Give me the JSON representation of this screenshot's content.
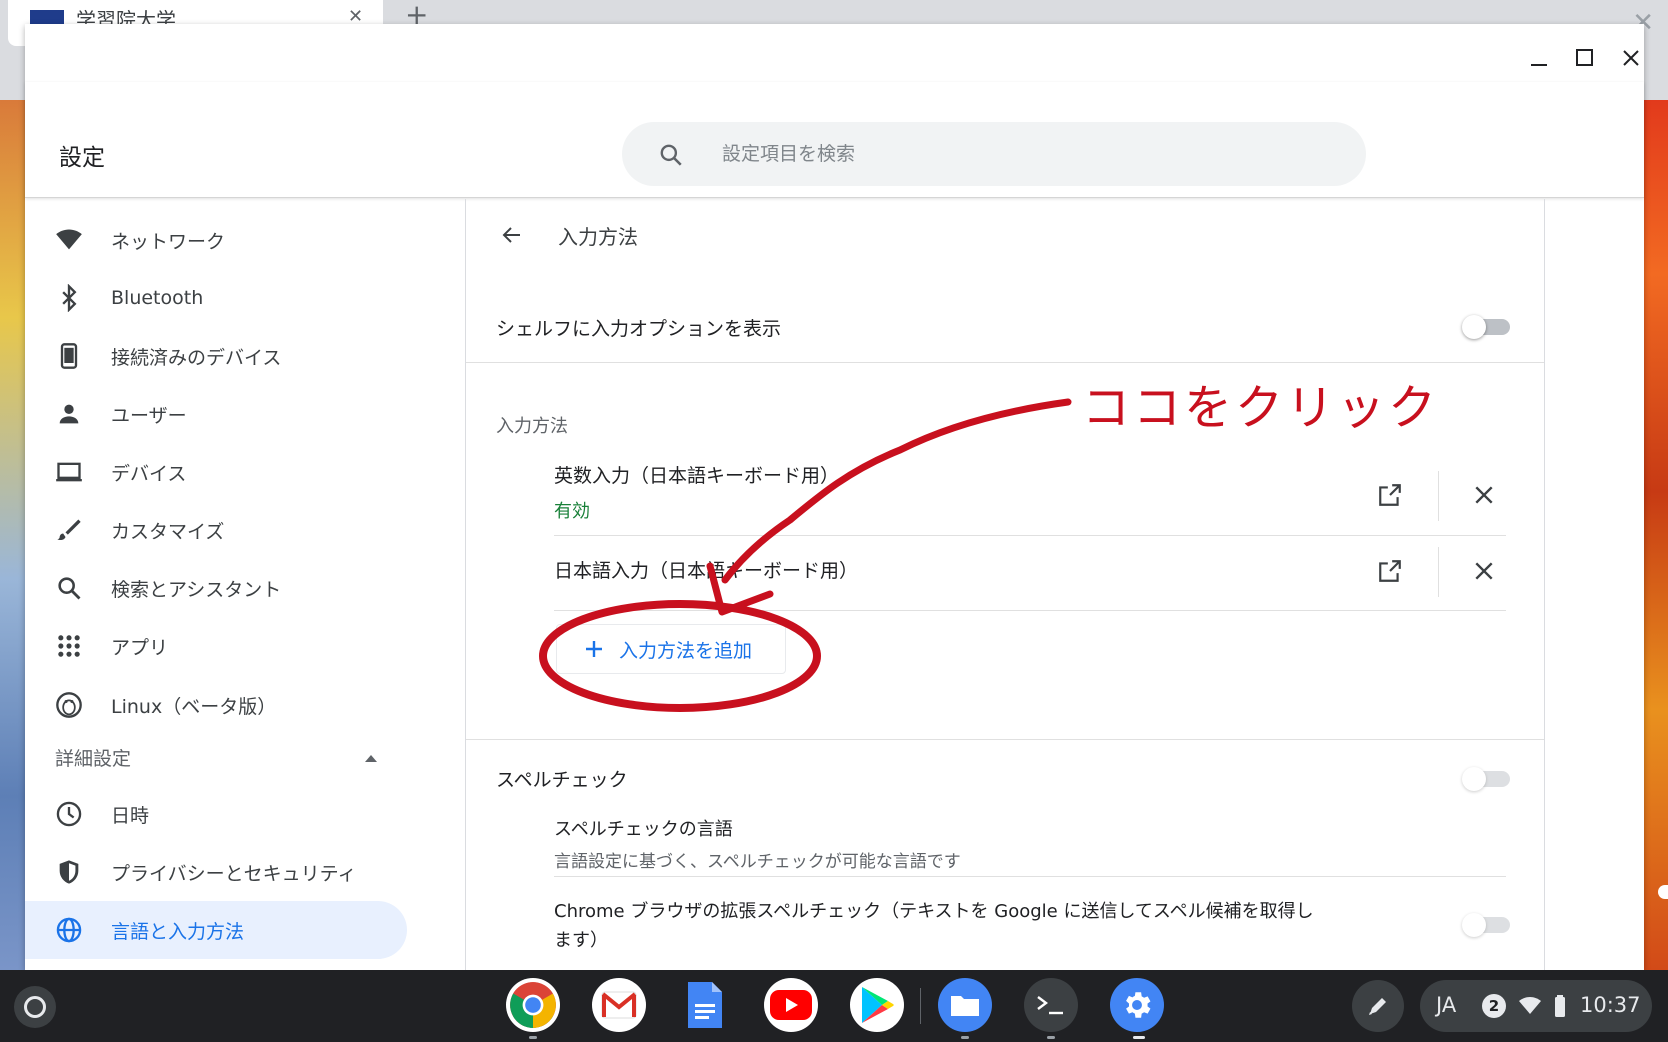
{
  "background_browser": {
    "tab_title": "学習院大学",
    "close_glyph": "✕",
    "newtab_glyph": "+"
  },
  "window": {
    "controls": {
      "minimize": "—",
      "maximize": "☐",
      "close": "✕"
    }
  },
  "header": {
    "title": "設定",
    "search_placeholder": "設定項目を検索"
  },
  "sidebar": {
    "items": [
      {
        "label": "ネットワーク",
        "icon": "wifi-icon"
      },
      {
        "label": "Bluetooth",
        "icon": "bluetooth-icon"
      },
      {
        "label": "接続済みのデバイス",
        "icon": "phone-icon"
      },
      {
        "label": "ユーザー",
        "icon": "person-icon"
      },
      {
        "label": "デバイス",
        "icon": "laptop-icon"
      },
      {
        "label": "カスタマイズ",
        "icon": "brush-icon"
      },
      {
        "label": "検索とアシスタント",
        "icon": "search-icon"
      },
      {
        "label": "アプリ",
        "icon": "apps-grid-icon"
      },
      {
        "label": "Linux（ベータ版）",
        "icon": "penguin-icon"
      }
    ],
    "advanced_label": "詳細設定",
    "advanced_items": [
      {
        "label": "日時",
        "icon": "clock-icon"
      },
      {
        "label": "プライバシーとセキュリティ",
        "icon": "shield-icon"
      },
      {
        "label": "言語と入力方法",
        "icon": "globe-icon",
        "active": true
      }
    ]
  },
  "main": {
    "subpage_title": "入力方法",
    "shelf_option_label": "シェルフに入力オプションを表示",
    "shelf_option_enabled": false,
    "input_methods_label": "入力方法",
    "input_methods": [
      {
        "name": "英数入力（日本語キーボード用）",
        "status": "有効"
      },
      {
        "name": "日本語入力（日本語キーボード用）",
        "status": ""
      }
    ],
    "add_button_label": "入力方法を追加",
    "spellcheck_label": "スペルチェック",
    "spellcheck_enabled": false,
    "spell_lang_title": "スペルチェックの言語",
    "spell_lang_desc": "言語設定に基づく、スペルチェックが可能な言語です",
    "enhanced_spell_line1": "Chrome ブラウザの拡張スペルチェック（テキストを Google に送信してスペル候補を取得し",
    "enhanced_spell_line2": "ます）",
    "enhanced_spell_enabled": false
  },
  "annotation": {
    "text": "ココをクリック",
    "color": "#c8101e"
  },
  "shelf": {
    "apps": [
      "chrome-icon",
      "gmail-icon",
      "docs-icon",
      "youtube-icon",
      "play-store-icon",
      "files-icon",
      "terminal-icon",
      "settings-icon"
    ],
    "tray": {
      "ime": "JA",
      "notification_count": "2",
      "time": "10:37"
    }
  }
}
